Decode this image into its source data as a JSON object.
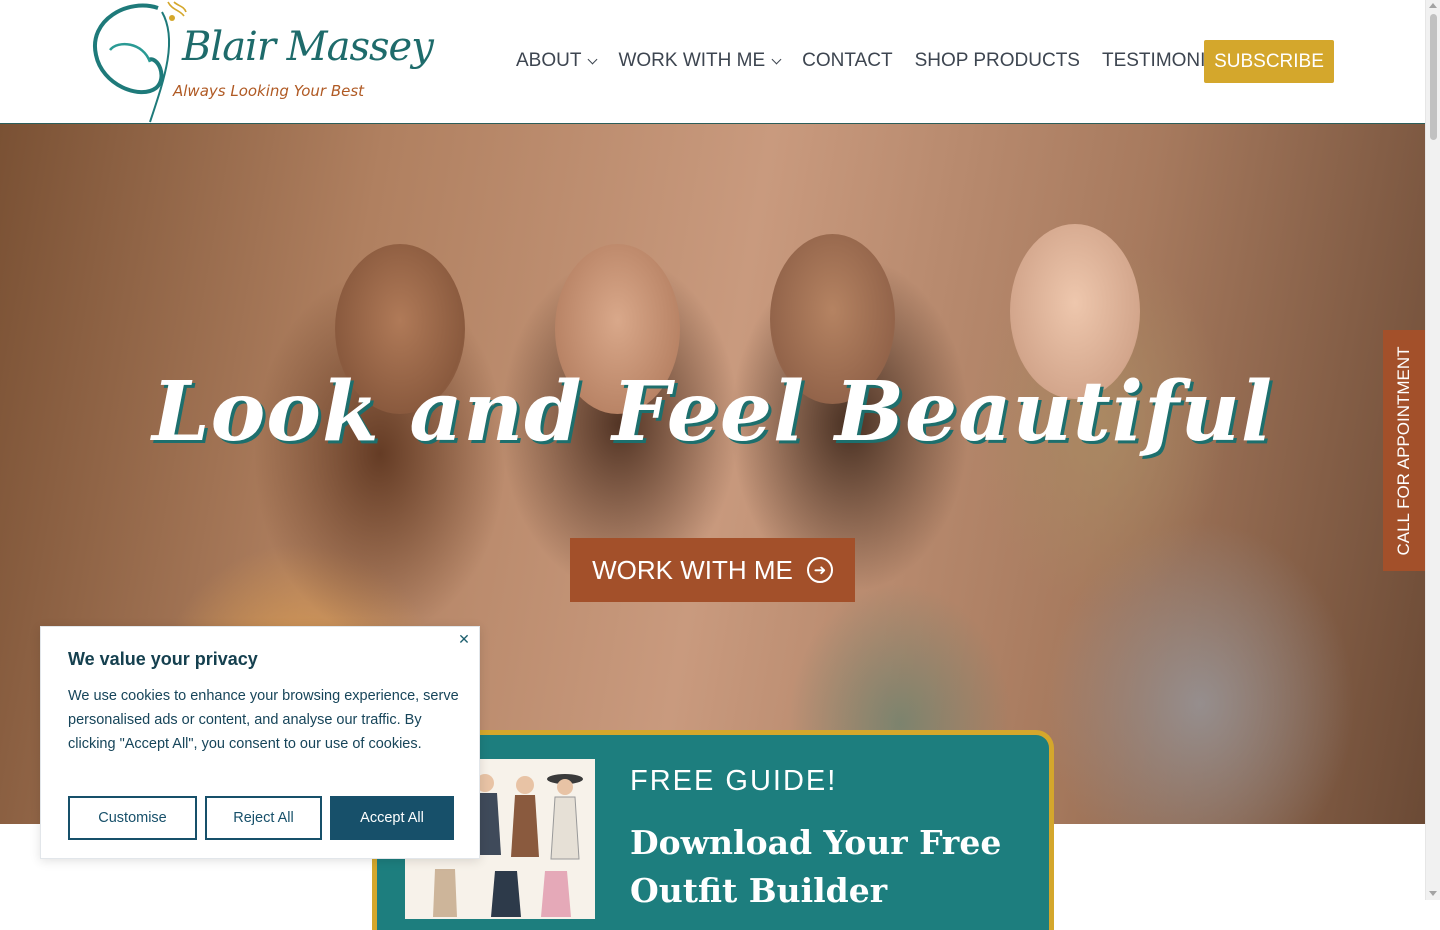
{
  "brand": {
    "name": "Blair Massey",
    "tagline": "Always Looking Your Best",
    "colors": {
      "teal": "#1d7e7e",
      "gold": "#d4a72c",
      "rust": "#a3502a",
      "navy": "#17506a"
    }
  },
  "nav": {
    "items": [
      {
        "label": "ABOUT",
        "has_dropdown": true
      },
      {
        "label": "WORK WITH ME",
        "has_dropdown": true
      },
      {
        "label": "CONTACT",
        "has_dropdown": false
      },
      {
        "label": "SHOP PRODUCTS",
        "has_dropdown": false
      },
      {
        "label": "TESTIMONIALS",
        "has_dropdown": false
      }
    ],
    "subscribe_label": "SUBSCRIBE"
  },
  "hero": {
    "title": "Look and Feel Beautiful",
    "cta_label": "WORK WITH ME",
    "cta_icon": "arrow-right-circle-icon"
  },
  "side_tab": {
    "label": "CALL FOR APPOINTMENT"
  },
  "guide": {
    "eyebrow": "FREE GUIDE!",
    "heading": "Download Your Free Outfit Builder"
  },
  "cookie": {
    "title": "We value your privacy",
    "text": "We use cookies to enhance your browsing experience, serve personalised ads or content, and analyse our traffic. By clicking \"Accept All\", you consent to our use of cookies.",
    "customise_label": "Customise",
    "reject_label": "Reject All",
    "accept_label": "Accept All",
    "close_icon": "close-icon"
  }
}
